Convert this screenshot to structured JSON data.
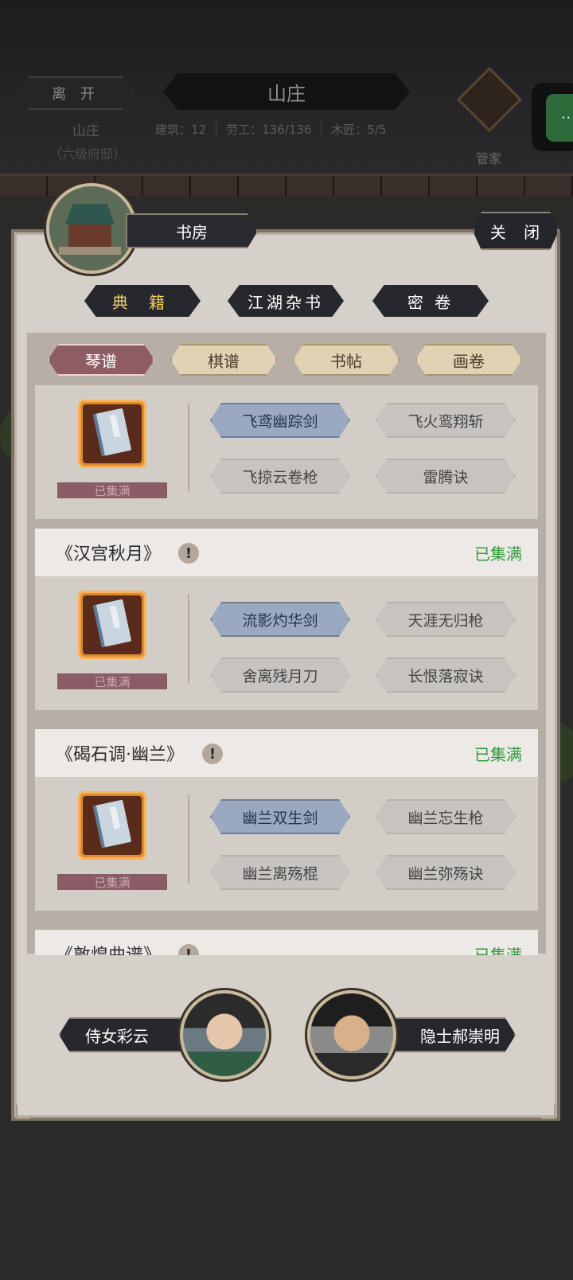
{
  "topbar": {
    "leave_label": "离 开",
    "location_name": "山庄",
    "location_level": "（六级府邸）",
    "title": "山庄",
    "stats": [
      "建筑：12",
      "劳工：136/136",
      "木匠：5/5"
    ],
    "steward_label": "管家",
    "mini_program_icon": "more-dots-icon"
  },
  "panel": {
    "room_title": "书房",
    "close_label": "关 闭",
    "category_tabs": [
      "典 籍",
      "江湖杂书",
      "密 卷"
    ],
    "active_category": 0,
    "sub_tabs": [
      "琴谱",
      "棋谱",
      "书帖",
      "画卷"
    ],
    "active_sub_tab": 0
  },
  "books": [
    {
      "name": "",
      "status": "",
      "progress_label": "已集满",
      "skills": [
        "飞鸢幽踪剑",
        "飞火鸾翔斩",
        "飞掠云卷枪",
        "雷腾诀"
      ]
    },
    {
      "name": "《汉宫秋月》",
      "status": "已集满",
      "progress_label": "已集满",
      "skills": [
        "流影灼华剑",
        "天涯无归枪",
        "舍离残月刀",
        "长恨落寂诀"
      ]
    },
    {
      "name": "《碣石调·幽兰》",
      "status": "已集满",
      "progress_label": "已集满",
      "skills": [
        "幽兰双生剑",
        "幽兰忘生枪",
        "幽兰离殇棍",
        "幽兰弥殇诀"
      ]
    },
    {
      "name": "《敦煌曲谱》",
      "status": "已集满"
    }
  ],
  "npcs": {
    "left_label": "侍女彩云",
    "right_label": "隐士郝崇明"
  },
  "colors": {
    "accent_gold": "#f0cf60",
    "complete_green": "#2e9c3a",
    "highlight_skill": "#9aa9bf",
    "active_subtab": "#8f5c63"
  }
}
